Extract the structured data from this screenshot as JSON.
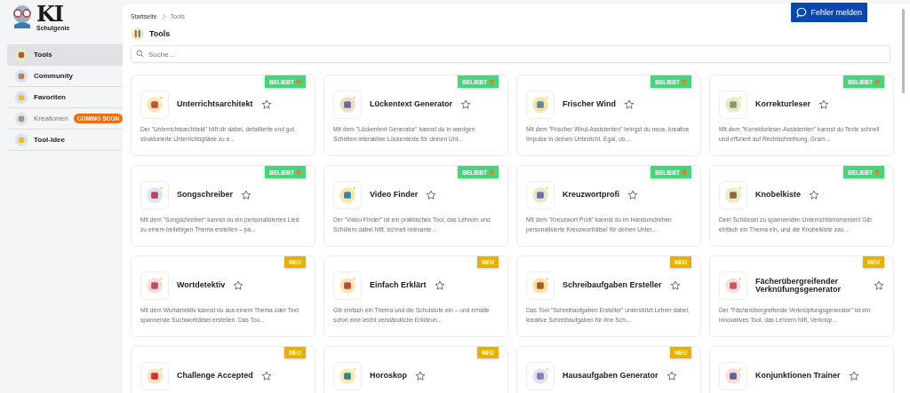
{
  "logo": {
    "title": "KI",
    "subtitle": "Schulgenie"
  },
  "sidebar": {
    "items": [
      {
        "label": "Tools",
        "selected": true,
        "disabled": false
      },
      {
        "label": "Community",
        "selected": false,
        "disabled": false
      },
      {
        "label": "Favoriten",
        "selected": false,
        "disabled": false
      },
      {
        "label": "Kreationen",
        "selected": false,
        "disabled": true,
        "badge": "COMING SOON"
      },
      {
        "label": "Tool-Idee",
        "selected": false,
        "disabled": false
      }
    ]
  },
  "breadcrumb": [
    "Startseite",
    "Tools"
  ],
  "report_button": "Fehler melden",
  "page_title": "Tools",
  "search": {
    "placeholder": "Suche..."
  },
  "cards": [
    {
      "title": "Unterrichtsarchitekt",
      "badge": {
        "kind": "popular",
        "label": "BELIEBT"
      },
      "description": "Der \"Unterrichtsarchitekt\" hilft dir dabei, detaillierte und gut strukturierte Unterrichtspläne zu e..."
    },
    {
      "title": "Lückentext Generator",
      "badge": {
        "kind": "popular",
        "label": "BELIEBT"
      },
      "description": "Mit dem \"Lückentext Generator\" kannst du in wenigen Schritten interaktive Lückentexte für deinen Unt..."
    },
    {
      "title": "Frischer Wind",
      "badge": {
        "kind": "popular",
        "label": "BELIEBT"
      },
      "description": "Mit dem \"Frischer Wind-Assistenten\" bringst du neue, kreative Impulse in deinen Unterricht. Egal, ob..."
    },
    {
      "title": "Korrekturleser",
      "badge": {
        "kind": "popular",
        "label": "BELIEBT"
      },
      "description": "Mit dem \"Korrekturleser-Assistenten\" kannst du Texte schnell und effizient auf Rechtschreibung, Gram..."
    },
    {
      "title": "Songschreiber",
      "badge": {
        "kind": "popular",
        "label": "BELIEBT"
      },
      "description": "Mit dem \"Songschreiber\" kannst du ein personalisiertes Lied zu einem beliebigen Thema erstellen – pa..."
    },
    {
      "title": "Video Finder",
      "badge": {
        "kind": "popular",
        "label": "BELIEBT"
      },
      "description": "Der \"Video Finder\" ist ein praktisches Tool, das Lehrern und Schülern dabei hilft, schnell relevante..."
    },
    {
      "title": "Kreuzwortprofi",
      "badge": {
        "kind": "popular",
        "label": "BELIEBT"
      },
      "description": "Mit dem \"Kreuzwort Profi\" kannst du im Handumdrehen personalisierte Kreuzworträtsel für deinen Unter..."
    },
    {
      "title": "Knobelkiste",
      "badge": {
        "kind": "popular",
        "label": "BELIEBT"
      },
      "description": "Dein Schlüssel zu spannenden Unterrichtsmomenten! Gib einfach ein Thema ein, und die Knobelkiste zau..."
    },
    {
      "title": "Wortdetektiv",
      "badge": {
        "kind": "new",
        "label": "NEU"
      },
      "description": "Mit dem Wortdetektiv kannst du aus einem Thema oder Text spannende Suchworträtsel erstellen. Das Too..."
    },
    {
      "title": "Einfach Erklärt",
      "badge": {
        "kind": "new",
        "label": "NEU"
      },
      "description": "Gib einfach ein Thema und die Schulstufe ein – und erhalte sofort eine leicht verständliche Erklärun..."
    },
    {
      "title": "Schreibaufgaben Ersteller",
      "badge": {
        "kind": "new",
        "label": "NEU"
      },
      "description": "Das Tool \"Schreibaufgaben Ersteller\" unterstützt Lehrer dabei, kreative Schreibaufgaben für ihre Sch..."
    },
    {
      "title": "Fächerübergreifender Verknüfungsgenerator",
      "badge": {
        "kind": "new",
        "label": "NEU"
      },
      "description": "Der \"Fächerübergreifende Verknüpfungsgenerator\" ist ein innovatives Tool, das Lehrern hilft, Verknüp..."
    },
    {
      "title": "Challenge Accepted",
      "badge": {
        "kind": "new",
        "label": "NEU"
      }
    },
    {
      "title": "Horoskop",
      "badge": {
        "kind": "new",
        "label": "NEU"
      }
    },
    {
      "title": "Hausaufgaben Generator",
      "badge": {
        "kind": "new",
        "label": "NEU"
      }
    },
    {
      "title": "Konjunktionen Trainer"
    }
  ]
}
